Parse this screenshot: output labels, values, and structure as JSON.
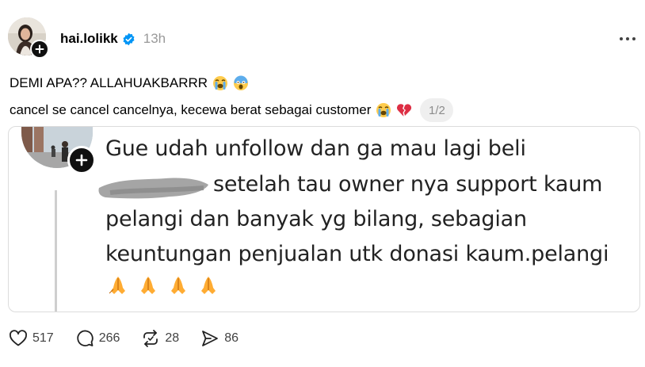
{
  "post": {
    "username": "hai.lolikk",
    "timestamp": "13h",
    "verified_color": "#0095f6",
    "line1": "DEMI APA?? ALLAHUAKBARRR",
    "line1_emojis": [
      "crying-face-emoji",
      "screaming-face-emoji"
    ],
    "line2": "cancel se cancel cancelnya, kecewa berat sebagai customer",
    "line2_emojis": [
      "crying-face-emoji",
      "broken-heart-emoji"
    ],
    "page_indicator": "1/2"
  },
  "quoted_image": {
    "lines": [
      "Gue udah unfollow dan ga mau lagi beli",
      "setelah tau owner nya support kaum",
      "pelangi dan banyak yg bilang, sebagian",
      "keuntungan penjualan utk donasi kaum.pelangi"
    ],
    "emojis": [
      "folded-hands-emoji",
      "folded-hands-emoji",
      "folded-hands-emoji",
      "folded-hands-emoji"
    ]
  },
  "actions": {
    "likes": "517",
    "comments": "266",
    "reposts": "28",
    "shares": "86"
  }
}
